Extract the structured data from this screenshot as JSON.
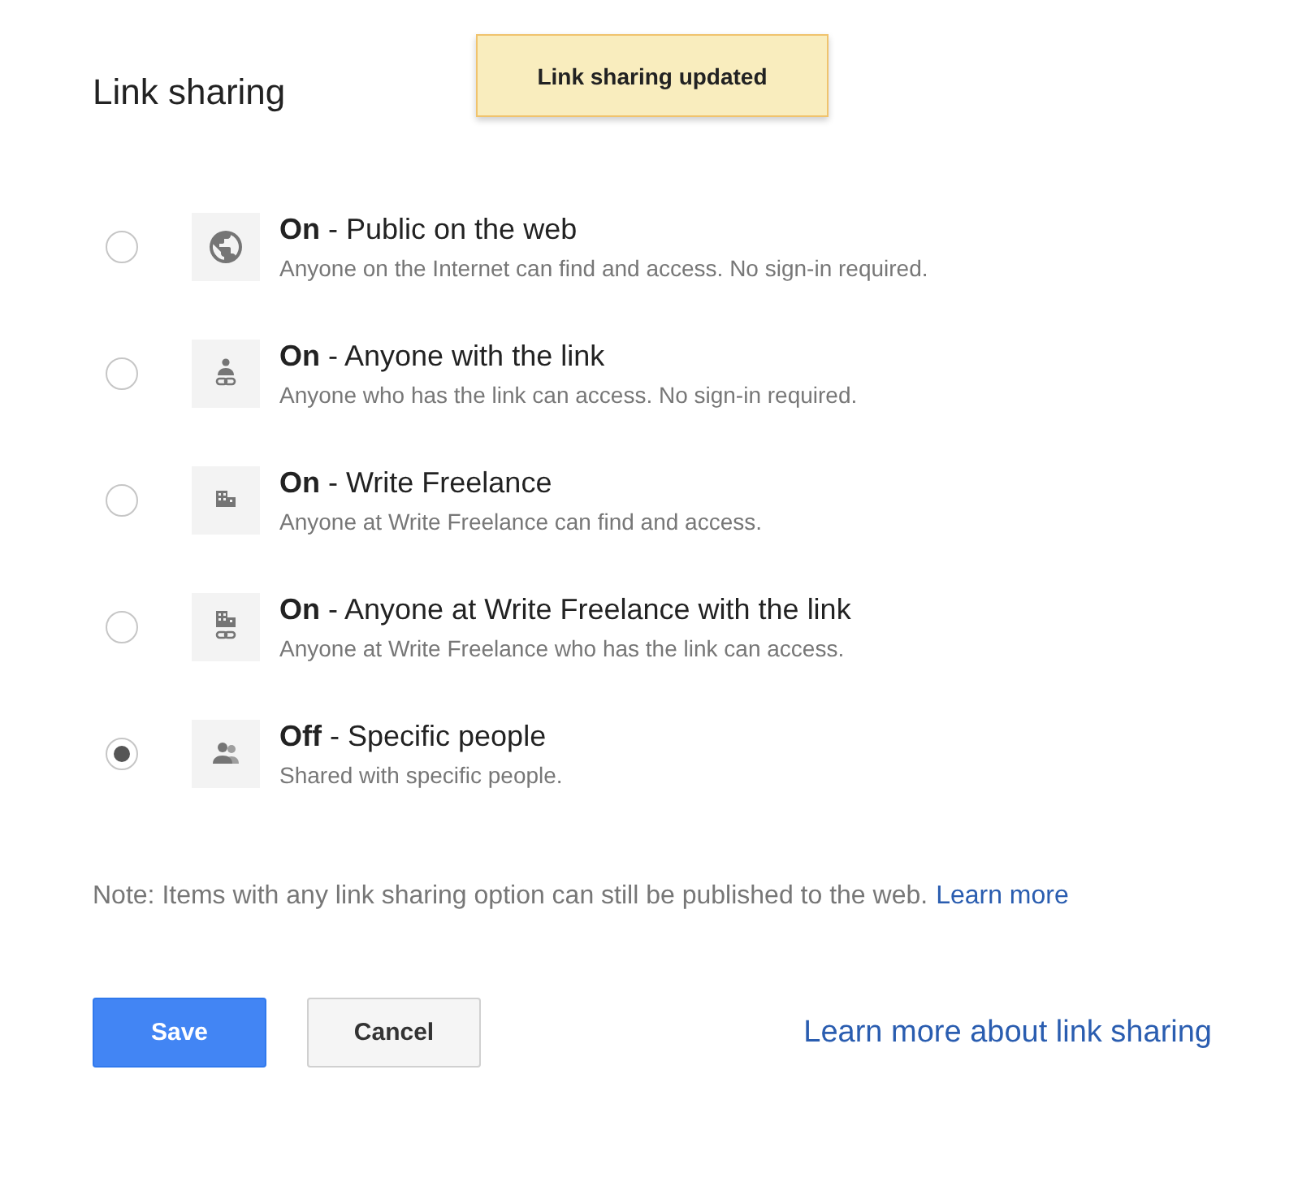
{
  "toast": {
    "text": "Link sharing updated"
  },
  "title": "Link sharing",
  "options": [
    {
      "kind": "globe",
      "title": "**On** - Public on the web",
      "description": "Anyone on the Internet can find and access. No sign-in required.",
      "selected": false
    },
    {
      "kind": "person-link",
      "title": "**On** - Anyone with the link",
      "description": "Anyone who has the link can access. No sign-in required.",
      "selected": false
    },
    {
      "kind": "building",
      "title": "**On** - Write Freelance",
      "description": "Anyone at Write Freelance can find and access.",
      "selected": false
    },
    {
      "kind": "building-link",
      "title": "**On** - Anyone at Write Freelance with the link",
      "description": "Anyone at Write Freelance who has the link can access.",
      "selected": false
    },
    {
      "kind": "people",
      "title": "**Off** - Specific people",
      "description": "Shared with specific people.",
      "selected": true
    }
  ],
  "note": {
    "text": "Note: Items with any link sharing option can still be published to the web.",
    "link": "Learn more"
  },
  "buttons": [
    {
      "kind": "primary",
      "label": "Save"
    },
    {
      "kind": "secondary",
      "label": "Cancel"
    }
  ],
  "help_link": "Learn more about link sharing"
}
